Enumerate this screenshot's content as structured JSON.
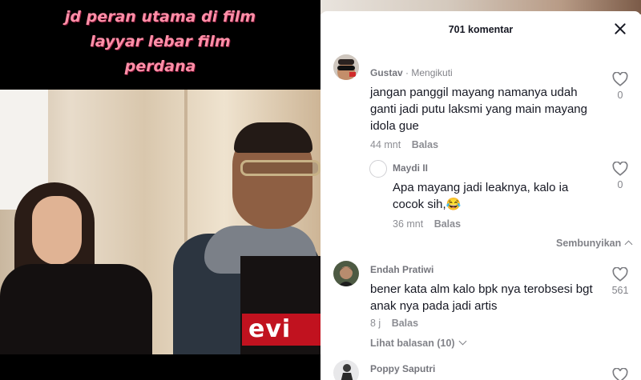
{
  "video": {
    "caption_lines": [
      "jd peran utama di film",
      "layyar lebar film",
      "perdana"
    ],
    "shirt_logo": "evi"
  },
  "comments_panel": {
    "title": "701 komentar",
    "comments": [
      {
        "name": "Gustav",
        "badge": "· Mengikuti",
        "text_lines": [
          "jangan panggil mayang namanya udah",
          "ganti jadi putu laksmi yang main mayang",
          "idola gue"
        ],
        "time": "44 mnt",
        "reply_label": "Balas",
        "likes": "0"
      },
      {
        "name": "Maydi II",
        "badge": "",
        "text_lines": [
          "Apa mayang jadi leaknya, kalo ia",
          "cocok sih,😂"
        ],
        "time": "36 mnt",
        "reply_label": "Balas",
        "likes": "0"
      },
      {
        "name": "Endah Pratiwi",
        "badge": "",
        "text_lines": [
          "bener kata alm kalo bpk nya terobsesi bgt",
          "anak nya pada jadi artis"
        ],
        "time": "8 j",
        "reply_label": "Balas",
        "likes": "561"
      },
      {
        "name": "Poppy Saputri",
        "badge": "",
        "text_lines": [],
        "time": "",
        "reply_label": "",
        "likes": ""
      }
    ],
    "hide_label": "Sembunyikan",
    "view_replies_label": "Lihat balasan (10)"
  },
  "colors": {
    "caption": "#ff8fa8",
    "text_primary": "#161823",
    "text_secondary": "#8a8b91"
  }
}
